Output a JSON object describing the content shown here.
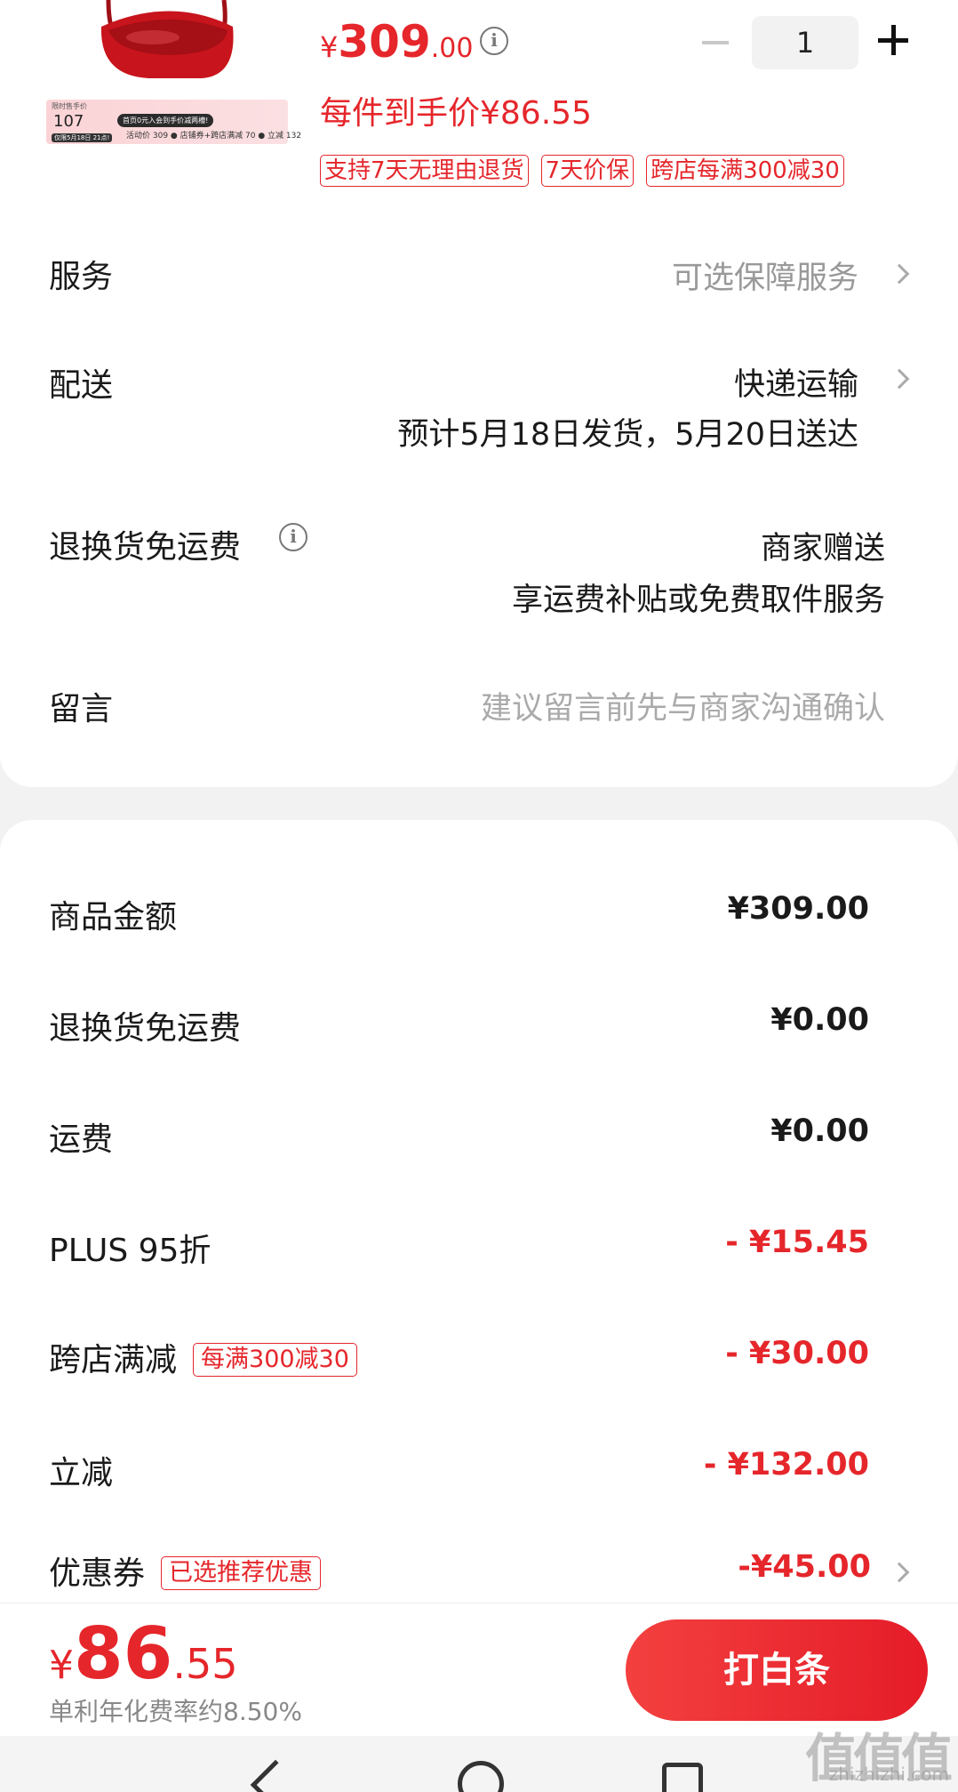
{
  "product": {
    "price_currency": "¥",
    "price_integer": "309",
    "price_decimal": ".00",
    "unit_price": "每件到手价¥86.55",
    "quantity": "1",
    "tags": [
      "支持7天无理由退货",
      "7天价保",
      "跨店每满300减30"
    ],
    "promo": {
      "label": "限时售手价",
      "price": "107",
      "pill": "首页0元入会到手价减两槽!",
      "line": "活动价 309 ● 店铺券+跨店满减 70 ● 立减 132",
      "date": "仅限5月18日 21点!"
    }
  },
  "rows": {
    "service_label": "服务",
    "service_value": "可选保障服务",
    "delivery_label": "配送",
    "delivery_value": "快递运输",
    "delivery_eta": "预计5月18日发货，5月20日送达",
    "return_label": "退换货免运费",
    "return_value": "商家赠送",
    "return_desc": "享运费补贴或免费取件服务",
    "message_label": "留言",
    "message_placeholder": "建议留言前先与商家沟通确认"
  },
  "summary": {
    "goods_label": "商品金额",
    "goods_value": "¥309.00",
    "return_label": "退换货免运费",
    "return_value": "¥0.00",
    "shipping_label": "运费",
    "shipping_value": "¥0.00",
    "plus_label": "PLUS 95折",
    "plus_value": "- ¥15.45",
    "cross_label": "跨店满减",
    "cross_tag": "每满300减30",
    "cross_value": "- ¥30.00",
    "instant_label": "立减",
    "instant_value": "- ¥132.00",
    "coupon_label": "优惠券",
    "coupon_tag": "已选推荐优惠",
    "coupon_value": "-¥45.00"
  },
  "footer": {
    "price_currency": "¥",
    "price_integer": "86",
    "price_decimal": ".55",
    "fee_note": "单利年化费率约8.50%",
    "pay_button": "打白条"
  },
  "watermark": {
    "text": "值值值",
    "sub": "zhizhizhi.com"
  },
  "colors": {
    "accent": "#e5262b",
    "muted": "#999999"
  }
}
